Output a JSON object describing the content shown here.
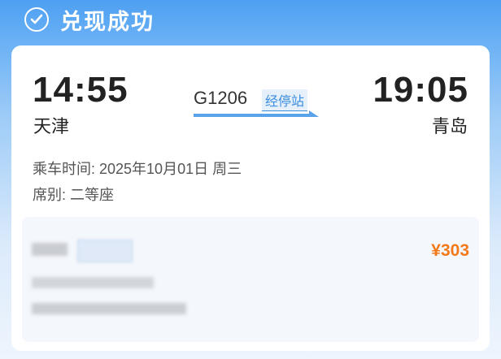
{
  "header": {
    "title": "兑现成功",
    "icon": "check-circle-icon"
  },
  "trip": {
    "departure_time": "14:55",
    "departure_station": "天津",
    "arrival_time": "19:05",
    "arrival_station": "青岛",
    "train_number": "G1206",
    "stops_link": "经停站",
    "ride_time": "乘车时间: 2025年10月01日 周三",
    "seat_class": "席别: 二等座"
  },
  "passenger": {
    "price": "¥303"
  },
  "colors": {
    "accent": "#3b8de0",
    "price": "#f27a1a",
    "header_bg": "#4ea0f2"
  }
}
